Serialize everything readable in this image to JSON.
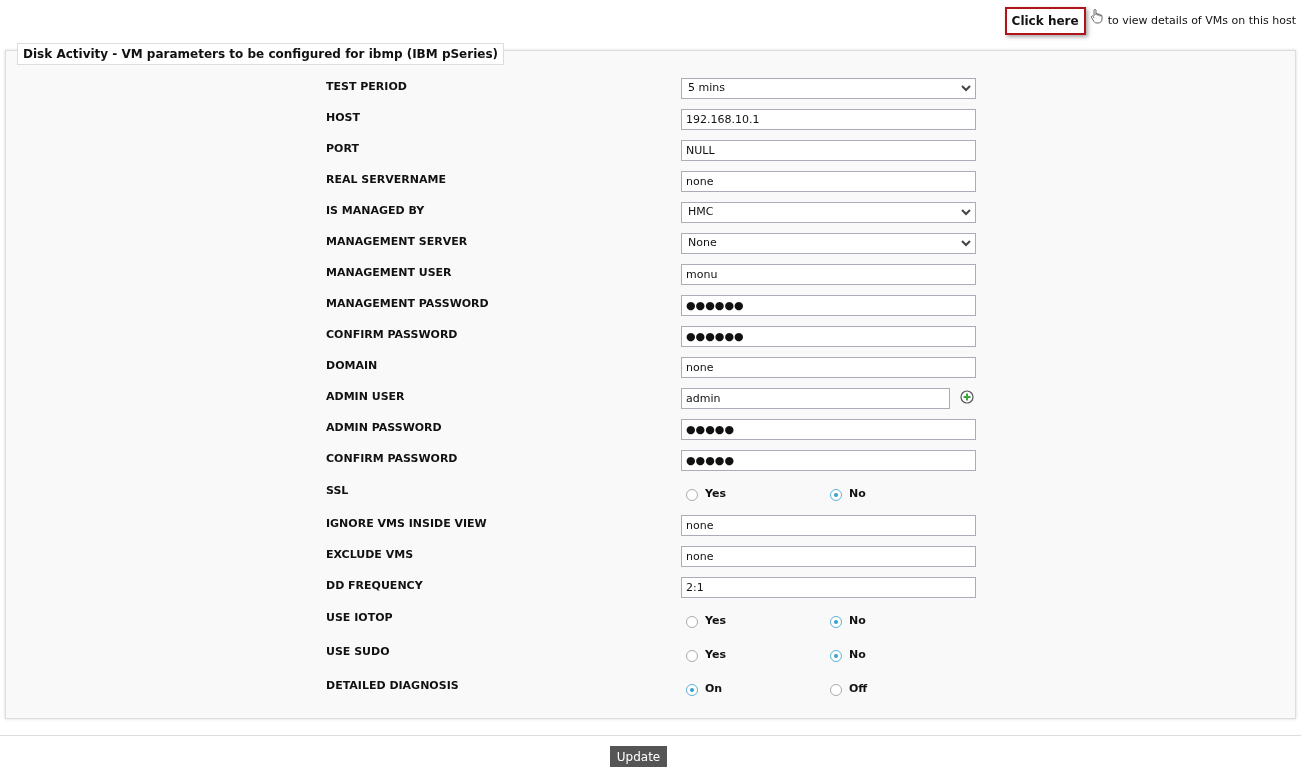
{
  "top_link": {
    "link": "Click here",
    "text": "to view details of VMs on this host"
  },
  "section": {
    "title": "Disk Activity - VM parameters to be configured for ibmp (IBM pSeries)"
  },
  "fields": [
    {
      "kind": "select",
      "label": "TEST PERIOD",
      "value": "5 mins"
    },
    {
      "kind": "text",
      "label": "HOST",
      "value": "192.168.10.1"
    },
    {
      "kind": "text",
      "label": "PORT",
      "value": "NULL"
    },
    {
      "kind": "text",
      "label": "REAL SERVERNAME",
      "value": "none"
    },
    {
      "kind": "select",
      "label": "IS MANAGED BY",
      "value": "HMC"
    },
    {
      "kind": "select",
      "label": "MANAGEMENT SERVER",
      "value": "None"
    },
    {
      "kind": "text",
      "label": "MANAGEMENT USER",
      "value": "monu"
    },
    {
      "kind": "password",
      "label": "MANAGEMENT PASSWORD",
      "value": "●●●●●●"
    },
    {
      "kind": "password",
      "label": "CONFIRM PASSWORD",
      "value": "●●●●●●"
    },
    {
      "kind": "text",
      "label": "DOMAIN",
      "value": "none"
    },
    {
      "kind": "text_add",
      "label": "ADMIN USER",
      "value": "admin"
    },
    {
      "kind": "password",
      "label": "ADMIN PASSWORD",
      "value": "●●●●●"
    },
    {
      "kind": "password",
      "label": "CONFIRM PASSWORD",
      "value": "●●●●●"
    },
    {
      "kind": "radio",
      "label": "SSL",
      "options": [
        {
          "label": "Yes",
          "selected": false
        },
        {
          "label": "No",
          "selected": true
        }
      ]
    },
    {
      "kind": "text",
      "label": "IGNORE VMS INSIDE VIEW",
      "value": "none"
    },
    {
      "kind": "text",
      "label": "EXCLUDE VMS",
      "value": "none"
    },
    {
      "kind": "text",
      "label": "DD FREQUENCY",
      "value": "2:1"
    },
    {
      "kind": "radio",
      "label": "USE IOTOP",
      "options": [
        {
          "label": "Yes",
          "selected": false
        },
        {
          "label": "No",
          "selected": true
        }
      ]
    },
    {
      "kind": "radio",
      "label": "USE SUDO",
      "options": [
        {
          "label": "Yes",
          "selected": false
        },
        {
          "label": "No",
          "selected": true
        }
      ]
    },
    {
      "kind": "radio",
      "label": "DETAILED DIAGNOSIS",
      "options": [
        {
          "label": "On",
          "selected": true
        },
        {
          "label": "Off",
          "selected": false
        }
      ]
    }
  ],
  "update_button": "Update"
}
